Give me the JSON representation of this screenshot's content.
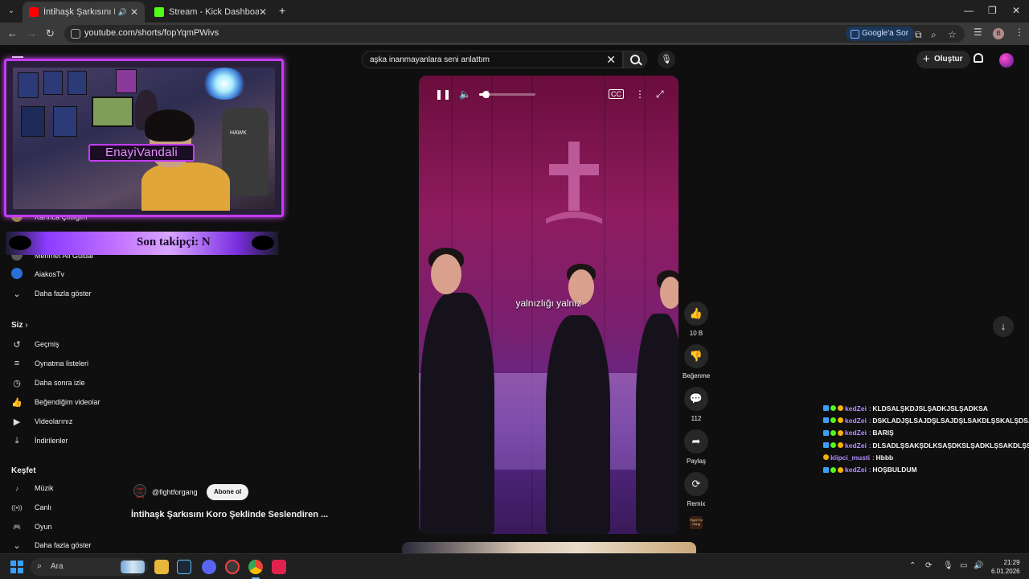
{
  "browser": {
    "tabs": [
      {
        "title": "İntihaşk Şarkısını Koro Şekli",
        "favicon_color": "#ff0000",
        "active": true,
        "close": "✕"
      },
      {
        "title": "Stream - Kick Dashboard",
        "favicon_color": "#53fc18",
        "active": false,
        "close": "✕"
      }
    ],
    "new_tab": "+",
    "url": "youtube.com/shorts/fopYqmPWivs",
    "google_ask_label": "Google'a Sor",
    "profile_initial": "B"
  },
  "youtube": {
    "search": {
      "query": "aşka inanmayanlara seni anlattım"
    },
    "create_label": "Oluştur",
    "sidebar": {
      "channels": [
        {
          "label": "Karınca Çiftliğim",
          "color": "#8a8a2a"
        },
        {
          "label": "Mehmet Ali Güldal",
          "color": "#5a5a5a"
        },
        {
          "label": "AiakosTv",
          "color": "#2a6fd8"
        }
      ],
      "show_more_1": "Daha fazla göster",
      "you_header": "Siz",
      "you_items": [
        {
          "label": "Geçmiş",
          "icon": "history-icon",
          "glyph": "↺"
        },
        {
          "label": "Oynatma listeleri",
          "icon": "playlists-icon",
          "glyph": "≡"
        },
        {
          "label": "Daha sonra izle",
          "icon": "watch-later-icon",
          "glyph": "◷"
        },
        {
          "label": "Beğendiğim videolar",
          "icon": "like-icon",
          "glyph": "👍"
        },
        {
          "label": "Videolarınız",
          "icon": "your-videos-icon",
          "glyph": "▶"
        },
        {
          "label": "İndirilenler",
          "icon": "downloads-icon",
          "glyph": "⤓"
        }
      ],
      "explore_header": "Keşfet",
      "explore_items": [
        {
          "label": "Müzik",
          "icon": "music-icon",
          "glyph": "♪"
        },
        {
          "label": "Canlı",
          "icon": "live-icon",
          "glyph": "((•))"
        },
        {
          "label": "Oyun",
          "icon": "gaming-icon",
          "glyph": "🎮"
        }
      ],
      "show_more_2": "Daha fazla göster"
    },
    "video": {
      "caption": "yalnızlığı yalnız",
      "volume_fraction": 0.12
    },
    "actions": {
      "like_count": "10 B",
      "dislike_label": "Beğenme",
      "comment_count": "112",
      "share_label": "Paylaş",
      "remix_label": "Remix"
    },
    "channel": {
      "handle": "@fightforgang",
      "subscribe_label": "Abone ol",
      "avatar_text": "Fight For Gang"
    },
    "video_title": "İntihaşk Şarkısını Koro Şeklinde Seslendiren ..."
  },
  "stream_overlay": {
    "streamer_name": "EnayiVandali",
    "chair_brand": "HAWK",
    "last_follower_label": "Son takipçi: N"
  },
  "chat": [
    {
      "user": "kedZei",
      "color": "#b18cff",
      "message": "KLDSALŞKDJSLŞADKJSLŞADKSA"
    },
    {
      "user": "kedZei",
      "color": "#b18cff",
      "message": "DSKLADJŞLSAJDŞLSAJDŞLSAKDLŞSKALŞDSA"
    },
    {
      "user": "kedZei",
      "color": "#b18cff",
      "message": "BARIŞ"
    },
    {
      "user": "kedZei",
      "color": "#b18cff",
      "message": "DLSADLŞSAKŞDLKSAŞDKSLŞADKLŞSAKDLŞSADKŞ"
    },
    {
      "user": "klipci_musti",
      "color": "#b18cff",
      "message": "Hbbb"
    },
    {
      "user": "kedZei",
      "color": "#b18cff",
      "message": "HOŞBULDUM"
    }
  ],
  "taskbar": {
    "search_placeholder": "Ara",
    "time": "21:29",
    "date": "6.01.2026"
  }
}
